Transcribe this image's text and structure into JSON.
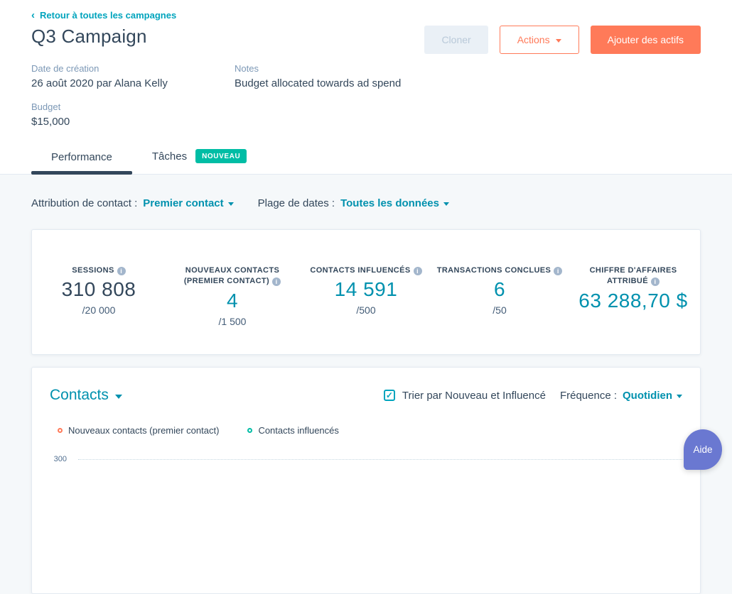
{
  "colors": {
    "accent_teal_link": "#0091ae",
    "accent_teal_bright": "#00a4bd",
    "accent_orange": "#ff7a59",
    "badge_teal": "#00bda5",
    "dark_text": "#33475b",
    "page_bg": "#f5f8fa",
    "help_purple": "#6a78d1",
    "stat_dark_value": "#33475b",
    "stat_teal_value": "#0091ae"
  },
  "header": {
    "back_link": "Retour à toutes les campagnes",
    "title": "Q3 Campaign",
    "buttons": {
      "clone": "Cloner",
      "actions": "Actions",
      "add_assets": "Ajouter des actifs"
    },
    "meta": [
      {
        "label": "Date de création",
        "value": "26 août 2020 par Alana Kelly"
      },
      {
        "label": "Notes",
        "value": "Budget allocated towards ad spend"
      },
      {
        "label": "Budget",
        "value": "$15,000"
      }
    ]
  },
  "tabs": {
    "performance": "Performance",
    "taches": "Tâches",
    "badge": "NOUVEAU"
  },
  "filters": {
    "attribution_label": "Attribution de contact :",
    "attribution_value": "Premier contact",
    "date_range_label": "Plage de dates :",
    "date_range_value": "Toutes les données"
  },
  "stats": [
    {
      "label": "SESSIONS",
      "value": "310 808",
      "target": "/20 000",
      "value_color": "#33475b"
    },
    {
      "label": "NOUVEAUX CONTACTS (PREMIER CONTACT)",
      "value": "4",
      "target": "/1 500",
      "value_color": "#0091ae"
    },
    {
      "label": "CONTACTS INFLUENCÉS",
      "value": "14 591",
      "target": "/500",
      "value_color": "#0091ae"
    },
    {
      "label": "TRANSACTIONS CONCLUES",
      "value": "6",
      "target": "/50",
      "value_color": "#0091ae"
    },
    {
      "label": "CHIFFRE D'AFFAIRES ATTRIBUÉ",
      "value": "63 288,70 $",
      "target": "",
      "value_color": "#0091ae"
    }
  ],
  "contacts_section": {
    "title": "Contacts",
    "sort_checkbox_label": "Trier par Nouveau et Influencé",
    "sort_checkbox_checked": "✓",
    "frequency_label": "Fréquence :",
    "frequency_value": "Quotidien",
    "legend": [
      {
        "label": "Nouveaux contacts (premier contact)",
        "color": "#ff7a59"
      },
      {
        "label": "Contacts influencés",
        "color": "#00bda5"
      }
    ],
    "y_axis_top_label": "300"
  },
  "help_button": {
    "label": "Aide",
    "color": "#6a78d1"
  }
}
